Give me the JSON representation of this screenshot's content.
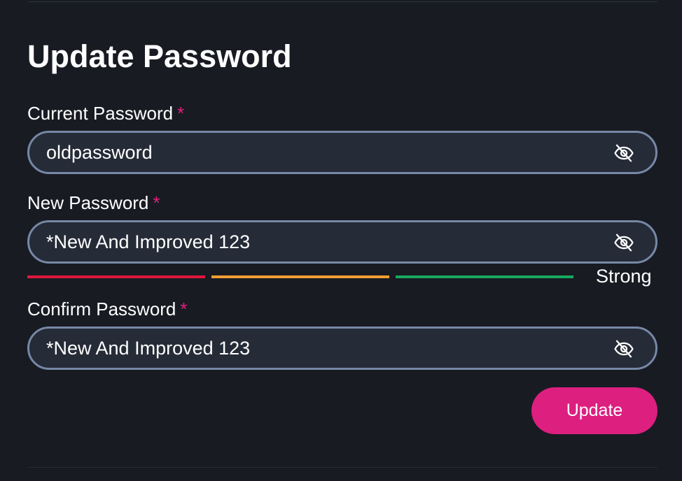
{
  "form": {
    "title": "Update Password",
    "required_marker": "*",
    "current_password": {
      "label": "Current Password",
      "value": "oldpassword"
    },
    "new_password": {
      "label": "New Password",
      "value": "*New And Improved 123",
      "strength": {
        "label": "Strong",
        "segments": [
          {
            "color": "#e0173c"
          },
          {
            "color": "#f29d31"
          },
          {
            "color": "#17a85f"
          }
        ]
      }
    },
    "confirm_password": {
      "label": "Confirm Password",
      "value": "*New And Improved 123"
    },
    "submit_label": "Update",
    "icons": {
      "visibility_toggle": "eye-slash-icon"
    },
    "colors": {
      "accent": "#dd1f80",
      "required": "#e0207c",
      "field_border": "#7688a6",
      "field_bg": "#252b37",
      "page_bg": "#181b22"
    }
  }
}
